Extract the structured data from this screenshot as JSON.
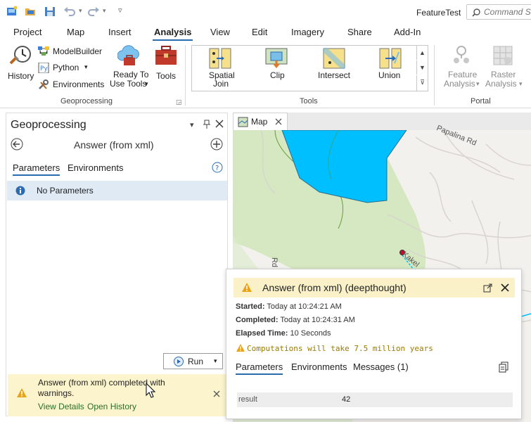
{
  "titlebar": {
    "title": "FeatureTest",
    "search_placeholder": "Command Search",
    "quick_access": [
      "new-project-icon",
      "open-project-icon",
      "save-icon",
      "undo-icon",
      "redo-icon",
      "customize-icon"
    ]
  },
  "ribbon": {
    "tabs": [
      {
        "label": "Project"
      },
      {
        "label": "Map"
      },
      {
        "label": "Insert"
      },
      {
        "label": "Analysis",
        "active": true
      },
      {
        "label": "View"
      },
      {
        "label": "Edit"
      },
      {
        "label": "Imagery"
      },
      {
        "label": "Share"
      },
      {
        "label": "Add-In"
      }
    ],
    "geoprocessing": {
      "group_label": "Geoprocessing",
      "history": "History",
      "modelbuilder": "ModelBuilder",
      "python": "Python",
      "environments": "Environments",
      "ready_line1": "Ready To",
      "ready_line2": "Use Tools",
      "tools": "Tools"
    },
    "tools": {
      "group_label": "Tools",
      "items": [
        {
          "label1": "Spatial",
          "label2": "Join",
          "icon": "spatial-join-icon"
        },
        {
          "label1": "Clip",
          "label2": "",
          "icon": "clip-icon"
        },
        {
          "label1": "Intersect",
          "label2": "",
          "icon": "intersect-icon"
        },
        {
          "label1": "Union",
          "label2": "",
          "icon": "union-icon"
        }
      ]
    },
    "portal": {
      "group_label": "Portal",
      "feature_1": "Feature",
      "feature_2": "Analysis",
      "raster_1": "Raster",
      "raster_2": "Analysis"
    }
  },
  "geoprocessing_pane": {
    "title": "Geoprocessing",
    "tool_name": "Answer (from xml)",
    "tab_parameters": "Parameters",
    "tab_environments": "Environments",
    "no_params": "No Parameters",
    "run": "Run"
  },
  "notification": {
    "line1": "Answer (from xml) completed with",
    "line2": "warnings.",
    "view_details": "View Details",
    "open_history": "Open History"
  },
  "map": {
    "tab_label": "Map",
    "road1": "Papalina Rd",
    "road2": "Rd",
    "road3": "Kakel"
  },
  "popup": {
    "title": "Answer (from xml) (deepthought)",
    "started_label": "Started:",
    "started_value": "Today at 10:24:21 AM",
    "completed_label": "Completed:",
    "completed_value": "Today at 10:24:31 AM",
    "elapsed_label": "Elapsed Time:",
    "elapsed_value": "10 Seconds",
    "warning": "Computations will take 7.5 million years",
    "tab_parameters": "Parameters",
    "tab_environments": "Environments",
    "tab_messages": "Messages (1)",
    "result_name": "result",
    "result_value": "42"
  },
  "colors": {
    "accent": "#2b6cb0",
    "warning_bg": "#fbf1c8",
    "map_water": "#00bfff",
    "map_green": "#cfe6b8",
    "link": "#2a6f2a",
    "warning_icon": "#e8a317"
  }
}
